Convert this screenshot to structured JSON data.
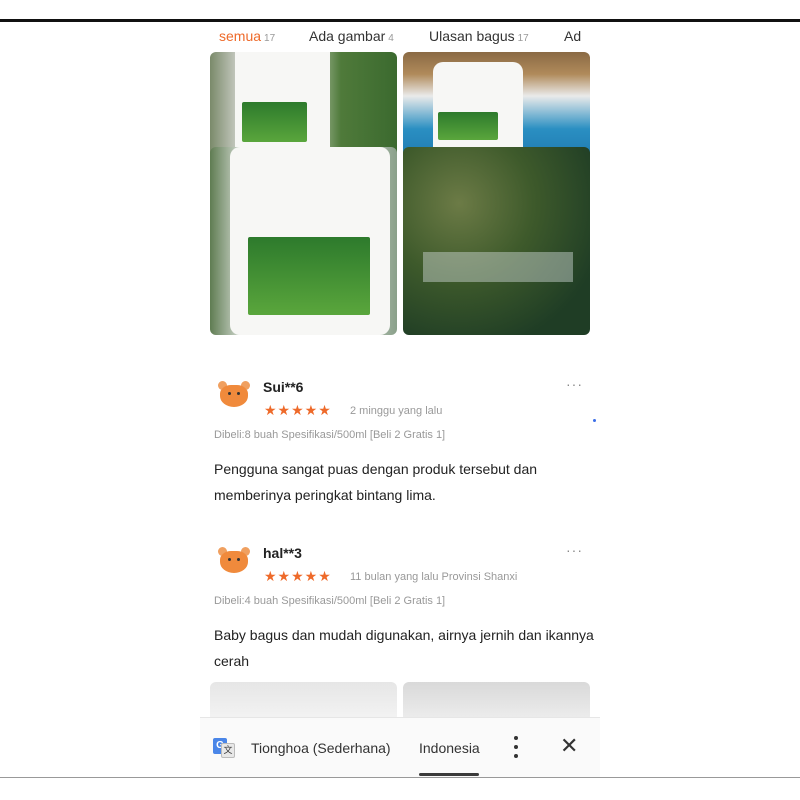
{
  "tabs": [
    {
      "label": "semua",
      "count": "17"
    },
    {
      "label": "Ada gambar",
      "count": "4"
    },
    {
      "label": "Ulasan bagus",
      "count": "17"
    },
    {
      "label": "Ad",
      "count": ""
    }
  ],
  "reviews": [
    {
      "username": "Sui**6",
      "stars": "★★★★★",
      "time": "2 minggu yang lalu",
      "meta": "Dibeli:8 buah  Spesifikasi/500ml [Beli 2 Gratis 1]",
      "text": "Pengguna sangat puas dengan produk tersebut dan memberinya peringkat bintang lima.",
      "more": "···"
    },
    {
      "username": "hal**3",
      "stars": "★★★★★",
      "time": "11 bulan yang lalu   Provinsi Shanxi",
      "meta": "Dibeli:4 buah  Spesifikasi/500ml [Beli 2 Gratis 1]",
      "text": "Baby bagus dan mudah digunakan, airnya jernih dan ikannya cerah",
      "more": "···"
    }
  ],
  "translate_bar": {
    "source_language": "Tionghoa (Sederhana)",
    "target_language": "Indonesia",
    "icon_letter_a": "G",
    "icon_letter_b": "文",
    "close": "✕"
  },
  "colors": {
    "accent": "#ee6a2a",
    "muted": "#999999"
  }
}
